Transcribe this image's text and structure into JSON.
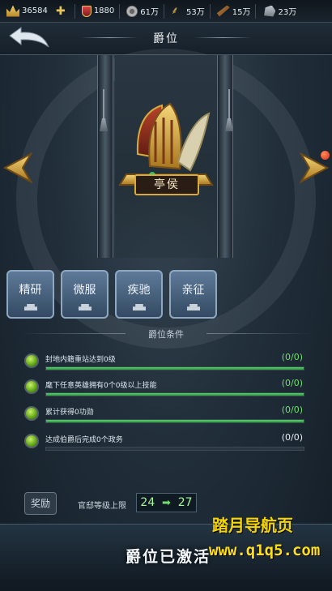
{
  "resources": [
    {
      "icon": "crown-icon",
      "value": "36584"
    },
    {
      "icon": "plus-icon",
      "value": ""
    },
    {
      "icon": "shield-icon",
      "value": "1880"
    },
    {
      "icon": "silver-coin-icon",
      "value": "61万"
    },
    {
      "icon": "wheat-icon",
      "value": "53万"
    },
    {
      "icon": "wood-icon",
      "value": "15万"
    },
    {
      "icon": "stone-icon",
      "value": "23万"
    }
  ],
  "header": {
    "title": "爵位"
  },
  "rank": {
    "name": "亭侯"
  },
  "skills": [
    "精研",
    "微服",
    "疾驰",
    "亲征"
  ],
  "conditions_title": "爵位条件",
  "conditions": [
    {
      "text": "封地内籍重站达到0级",
      "count": "(0/0)",
      "progress": 1,
      "done": true
    },
    {
      "text": "麾下任意英雄拥有0个0级以上技能",
      "count": "(0/0)",
      "progress": 1,
      "done": true
    },
    {
      "text": "累计获得0功勋",
      "count": "(0/0)",
      "progress": 1,
      "done": true
    },
    {
      "text": "达成伯爵后完成0个政务",
      "count": "(0/0)",
      "progress": 0,
      "done": false
    }
  ],
  "reward": {
    "label": "奖励",
    "level_label": "官邸等级上限",
    "from": "24",
    "to": "27"
  },
  "status": "爵位已激活",
  "watermark": {
    "line1": "踏月导航页",
    "line2": "www.q1q5.com"
  },
  "colors": {
    "progress": "#2a9a3c",
    "count_done": "#6fe06a",
    "count_pending": "#e6eef4",
    "gold": "#d7aa3c"
  }
}
